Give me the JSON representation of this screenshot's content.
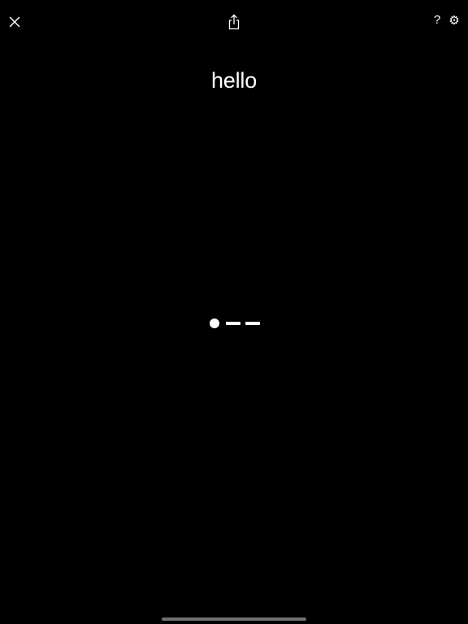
{
  "toolbar": {
    "close_icon": "close-icon",
    "share_icon": "share-icon",
    "help_label": "?",
    "settings_glyph": "⚙"
  },
  "main": {
    "word": "hello",
    "morse_pattern": [
      ".",
      "-",
      "-"
    ]
  },
  "colors": {
    "background": "#000000",
    "foreground": "#ffffff",
    "home_indicator": "#6f6f6f"
  }
}
